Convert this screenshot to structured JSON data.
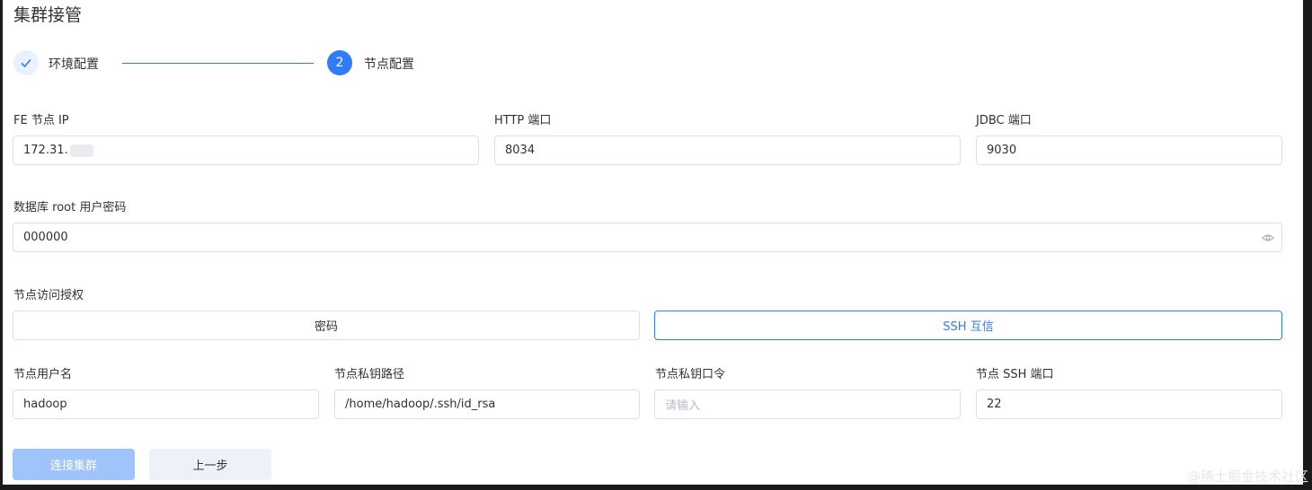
{
  "page": {
    "title": "集群接管"
  },
  "steps": [
    {
      "label": "环境配置",
      "status": "done"
    },
    {
      "label": "节点配置",
      "number": "2",
      "status": "active"
    }
  ],
  "form": {
    "fe_ip": {
      "label": "FE 节点 IP",
      "value": "172.31."
    },
    "http_port": {
      "label": "HTTP 端口",
      "value": "8034"
    },
    "jdbc_port": {
      "label": "JDBC 端口",
      "value": "9030"
    },
    "root_password": {
      "label": "数据库 root 用户密码",
      "value": "000000"
    },
    "auth": {
      "label": "节点访问授权",
      "options": [
        "密码",
        "SSH 互信"
      ],
      "selected": "SSH 互信"
    },
    "node_user": {
      "label": "节点用户名",
      "value": "hadoop"
    },
    "key_path": {
      "label": "节点私钥路径",
      "value": "/home/hadoop/.ssh/id_rsa"
    },
    "key_passphrase": {
      "label": "节点私钥口令",
      "placeholder": "请输入"
    },
    "ssh_port": {
      "label": "节点 SSH 端口",
      "value": "22"
    }
  },
  "actions": {
    "connect": "连接集群",
    "prev": "上一步"
  },
  "watermark": "@稀土掘金技术社区",
  "colors": {
    "primary": "#2f7cf6",
    "primary_disabled": "#9ec4fb",
    "border": "#dcdfe6"
  }
}
